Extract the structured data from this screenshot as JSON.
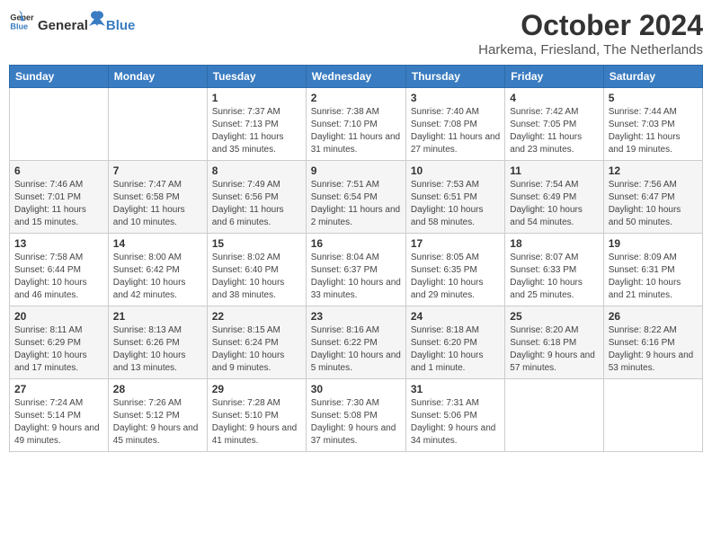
{
  "header": {
    "logo_general": "General",
    "logo_blue": "Blue",
    "month_title": "October 2024",
    "location": "Harkema, Friesland, The Netherlands"
  },
  "days_of_week": [
    "Sunday",
    "Monday",
    "Tuesday",
    "Wednesday",
    "Thursday",
    "Friday",
    "Saturday"
  ],
  "weeks": [
    [
      {
        "day": "",
        "info": ""
      },
      {
        "day": "",
        "info": ""
      },
      {
        "day": "1",
        "info": "Sunrise: 7:37 AM\nSunset: 7:13 PM\nDaylight: 11 hours and 35 minutes."
      },
      {
        "day": "2",
        "info": "Sunrise: 7:38 AM\nSunset: 7:10 PM\nDaylight: 11 hours and 31 minutes."
      },
      {
        "day": "3",
        "info": "Sunrise: 7:40 AM\nSunset: 7:08 PM\nDaylight: 11 hours and 27 minutes."
      },
      {
        "day": "4",
        "info": "Sunrise: 7:42 AM\nSunset: 7:05 PM\nDaylight: 11 hours and 23 minutes."
      },
      {
        "day": "5",
        "info": "Sunrise: 7:44 AM\nSunset: 7:03 PM\nDaylight: 11 hours and 19 minutes."
      }
    ],
    [
      {
        "day": "6",
        "info": "Sunrise: 7:46 AM\nSunset: 7:01 PM\nDaylight: 11 hours and 15 minutes."
      },
      {
        "day": "7",
        "info": "Sunrise: 7:47 AM\nSunset: 6:58 PM\nDaylight: 11 hours and 10 minutes."
      },
      {
        "day": "8",
        "info": "Sunrise: 7:49 AM\nSunset: 6:56 PM\nDaylight: 11 hours and 6 minutes."
      },
      {
        "day": "9",
        "info": "Sunrise: 7:51 AM\nSunset: 6:54 PM\nDaylight: 11 hours and 2 minutes."
      },
      {
        "day": "10",
        "info": "Sunrise: 7:53 AM\nSunset: 6:51 PM\nDaylight: 10 hours and 58 minutes."
      },
      {
        "day": "11",
        "info": "Sunrise: 7:54 AM\nSunset: 6:49 PM\nDaylight: 10 hours and 54 minutes."
      },
      {
        "day": "12",
        "info": "Sunrise: 7:56 AM\nSunset: 6:47 PM\nDaylight: 10 hours and 50 minutes."
      }
    ],
    [
      {
        "day": "13",
        "info": "Sunrise: 7:58 AM\nSunset: 6:44 PM\nDaylight: 10 hours and 46 minutes."
      },
      {
        "day": "14",
        "info": "Sunrise: 8:00 AM\nSunset: 6:42 PM\nDaylight: 10 hours and 42 minutes."
      },
      {
        "day": "15",
        "info": "Sunrise: 8:02 AM\nSunset: 6:40 PM\nDaylight: 10 hours and 38 minutes."
      },
      {
        "day": "16",
        "info": "Sunrise: 8:04 AM\nSunset: 6:37 PM\nDaylight: 10 hours and 33 minutes."
      },
      {
        "day": "17",
        "info": "Sunrise: 8:05 AM\nSunset: 6:35 PM\nDaylight: 10 hours and 29 minutes."
      },
      {
        "day": "18",
        "info": "Sunrise: 8:07 AM\nSunset: 6:33 PM\nDaylight: 10 hours and 25 minutes."
      },
      {
        "day": "19",
        "info": "Sunrise: 8:09 AM\nSunset: 6:31 PM\nDaylight: 10 hours and 21 minutes."
      }
    ],
    [
      {
        "day": "20",
        "info": "Sunrise: 8:11 AM\nSunset: 6:29 PM\nDaylight: 10 hours and 17 minutes."
      },
      {
        "day": "21",
        "info": "Sunrise: 8:13 AM\nSunset: 6:26 PM\nDaylight: 10 hours and 13 minutes."
      },
      {
        "day": "22",
        "info": "Sunrise: 8:15 AM\nSunset: 6:24 PM\nDaylight: 10 hours and 9 minutes."
      },
      {
        "day": "23",
        "info": "Sunrise: 8:16 AM\nSunset: 6:22 PM\nDaylight: 10 hours and 5 minutes."
      },
      {
        "day": "24",
        "info": "Sunrise: 8:18 AM\nSunset: 6:20 PM\nDaylight: 10 hours and 1 minute."
      },
      {
        "day": "25",
        "info": "Sunrise: 8:20 AM\nSunset: 6:18 PM\nDaylight: 9 hours and 57 minutes."
      },
      {
        "day": "26",
        "info": "Sunrise: 8:22 AM\nSunset: 6:16 PM\nDaylight: 9 hours and 53 minutes."
      }
    ],
    [
      {
        "day": "27",
        "info": "Sunrise: 7:24 AM\nSunset: 5:14 PM\nDaylight: 9 hours and 49 minutes."
      },
      {
        "day": "28",
        "info": "Sunrise: 7:26 AM\nSunset: 5:12 PM\nDaylight: 9 hours and 45 minutes."
      },
      {
        "day": "29",
        "info": "Sunrise: 7:28 AM\nSunset: 5:10 PM\nDaylight: 9 hours and 41 minutes."
      },
      {
        "day": "30",
        "info": "Sunrise: 7:30 AM\nSunset: 5:08 PM\nDaylight: 9 hours and 37 minutes."
      },
      {
        "day": "31",
        "info": "Sunrise: 7:31 AM\nSunset: 5:06 PM\nDaylight: 9 hours and 34 minutes."
      },
      {
        "day": "",
        "info": ""
      },
      {
        "day": "",
        "info": ""
      }
    ]
  ]
}
